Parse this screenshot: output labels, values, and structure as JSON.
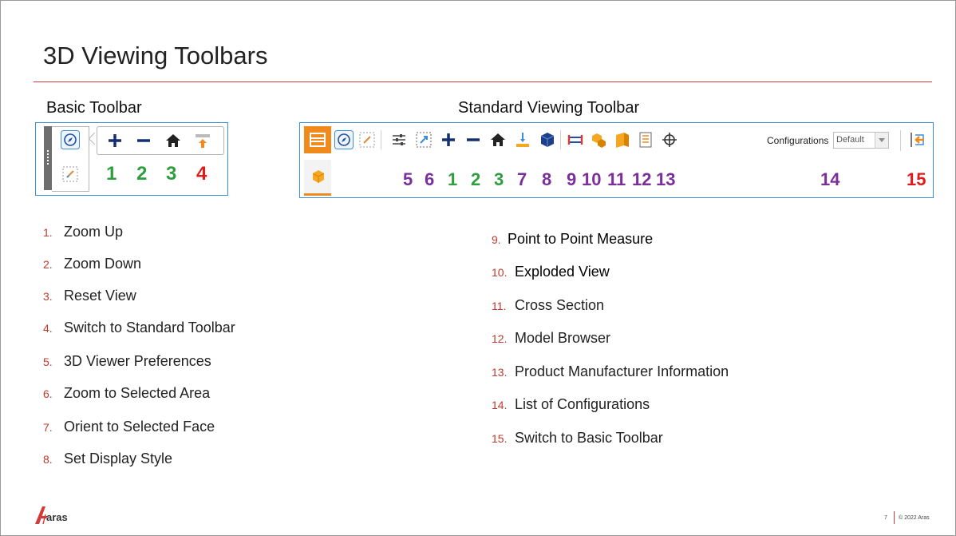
{
  "slide": {
    "title": "3D Viewing Toolbars"
  },
  "basic_toolbar": {
    "heading": "Basic Toolbar",
    "numbers": [
      {
        "text": "1",
        "color": "#2e9e3f"
      },
      {
        "text": "2",
        "color": "#2e9e3f"
      },
      {
        "text": "3",
        "color": "#2e9e3f"
      },
      {
        "text": "4",
        "color": "#e01b1b"
      }
    ],
    "icons": [
      "preferences-compass-icon",
      "zoom-area-icon",
      "zoom-in-icon",
      "zoom-out-icon",
      "home-icon",
      "switch-toolbar-icon"
    ]
  },
  "standard_toolbar": {
    "heading": "Standard Viewing Toolbar",
    "configurations_label": "Configurations",
    "configurations_value": "Default",
    "numbers": [
      {
        "text": "5",
        "color": "#7b2f99"
      },
      {
        "text": "6",
        "color": "#7b2f99"
      },
      {
        "text": "1",
        "color": "#2e9e3f"
      },
      {
        "text": "2",
        "color": "#2e9e3f"
      },
      {
        "text": "3",
        "color": "#2e9e3f"
      },
      {
        "text": "7",
        "color": "#7b2f99"
      },
      {
        "text": "8",
        "color": "#7b2f99"
      },
      {
        "text": "9",
        "color": "#7b2f99"
      },
      {
        "text": "10",
        "color": "#7b2f99"
      },
      {
        "text": "11",
        "color": "#7b2f99"
      },
      {
        "text": "12",
        "color": "#7b2f99"
      },
      {
        "text": "13",
        "color": "#7b2f99"
      },
      {
        "text": "14",
        "color": "#7b2f99"
      },
      {
        "text": "15",
        "color": "#e01b1b"
      }
    ],
    "icons": [
      "panel-toggle-icon",
      "preferences-compass-icon",
      "zoom-area-icon",
      "sliders-icon",
      "zoom-selected-icon",
      "zoom-in-icon",
      "zoom-out-icon",
      "home-icon",
      "orient-face-icon",
      "display-style-cube-icon",
      "measure-icon",
      "exploded-view-icon",
      "cross-section-icon",
      "model-browser-icon",
      "pmi-crosshair-icon",
      "switch-basic-icon",
      "cube-tab-icon"
    ]
  },
  "list_left": [
    {
      "num": "1.",
      "label": "Zoom Up"
    },
    {
      "num": "2.",
      "label": "Zoom Down"
    },
    {
      "num": "3.",
      "label": "Reset View"
    },
    {
      "num": "4.",
      "label": "Switch to Standard Toolbar"
    },
    {
      "num": "5.",
      "label": "3D Viewer Preferences"
    },
    {
      "num": "6.",
      "label": "Zoom to Selected Area"
    },
    {
      "num": "7.",
      "label": "Orient to Selected Face"
    },
    {
      "num": "8.",
      "label": "Set Display Style"
    }
  ],
  "list_right": [
    {
      "num": "9.",
      "label": "Point to Point Measure"
    },
    {
      "num": "10.",
      "label": "Exploded View"
    },
    {
      "num": "11.",
      "label": "Cross Section"
    },
    {
      "num": "12.",
      "label": "Model Browser"
    },
    {
      "num": "13.",
      "label": "Product Manufacturer Information"
    },
    {
      "num": "14.",
      "label": "List of Configurations"
    },
    {
      "num": "15.",
      "label": "Switch to Basic Toolbar"
    }
  ],
  "footer": {
    "logo_text": "aras",
    "page": "7",
    "copyright": "© 2022 Aras"
  },
  "colors": {
    "accent_red": "#d43a3a",
    "toolbar_border": "#3b8ed8",
    "orange": "#f08a1c",
    "number_purple": "#7b2f99",
    "number_green": "#2e9e3f",
    "number_red": "#e01b1b"
  }
}
